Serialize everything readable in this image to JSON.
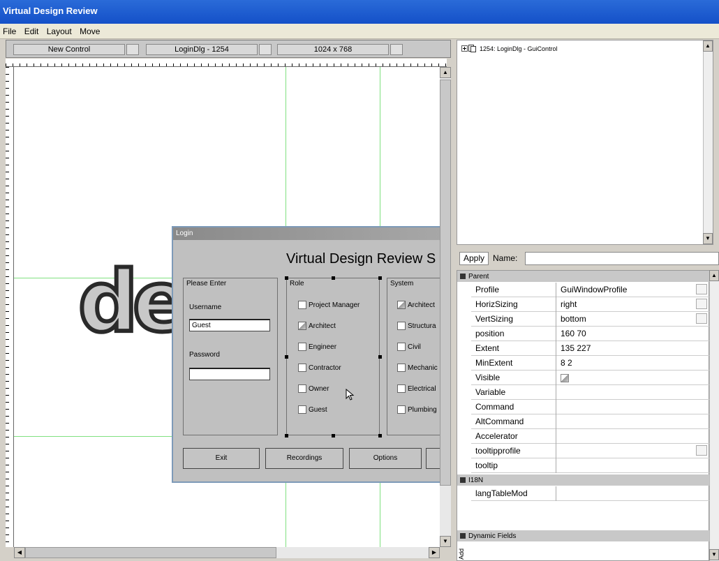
{
  "window": {
    "title": "Virtual Design Review"
  },
  "menu": [
    "File",
    "Edit",
    "Layout",
    "Move"
  ],
  "control_bar": {
    "new_control": "New Control",
    "control_name": "LoginDlg - 1254",
    "resolution": "1024 x 768"
  },
  "canvas": {
    "logo_text": "de",
    "dialog": {
      "title": "Login",
      "heading": "Virtual Design Review S",
      "please_enter": {
        "label": "Please Enter",
        "username_label": "Username",
        "username_value": "Guest",
        "password_label": "Password",
        "password_value": ""
      },
      "role": {
        "label": "Role",
        "options": [
          {
            "label": "Project Manager",
            "checked": false
          },
          {
            "label": "Architect",
            "checked": true
          },
          {
            "label": "Engineer",
            "checked": false
          },
          {
            "label": "Contractor",
            "checked": false
          },
          {
            "label": "Owner",
            "checked": false
          },
          {
            "label": "Guest",
            "checked": false
          }
        ]
      },
      "system": {
        "label": "System",
        "options": [
          {
            "label": "Architect",
            "checked": true
          },
          {
            "label": "Structura",
            "checked": false
          },
          {
            "label": "Civil",
            "checked": false
          },
          {
            "label": "Mechanic",
            "checked": false
          },
          {
            "label": "Electrical",
            "checked": false
          },
          {
            "label": "Plumbing",
            "checked": false
          }
        ]
      },
      "buttons": [
        "Exit",
        "Recordings",
        "Options"
      ]
    }
  },
  "tree": {
    "item": "1254: LoginDlg - GuiControl"
  },
  "inspector": {
    "apply": "Apply",
    "name_label": "Name:",
    "sections": {
      "parent": "Parent",
      "i18n": "I18N",
      "dynamic": "Dynamic Fields"
    },
    "parent_fields": [
      {
        "name": "Profile",
        "value": "GuiWindowProfile"
      },
      {
        "name": "HorizSizing",
        "value": "right"
      },
      {
        "name": "VertSizing",
        "value": "bottom"
      },
      {
        "name": "position",
        "value": "160 70"
      },
      {
        "name": "Extent",
        "value": "135 227"
      },
      {
        "name": "MinExtent",
        "value": "8 2"
      },
      {
        "name": "Visible",
        "value": ""
      },
      {
        "name": "Variable",
        "value": ""
      },
      {
        "name": "Command",
        "value": ""
      },
      {
        "name": "AltCommand",
        "value": ""
      },
      {
        "name": "Accelerator",
        "value": ""
      },
      {
        "name": "tooltipprofile",
        "value": ""
      },
      {
        "name": "tooltip",
        "value": ""
      }
    ],
    "i18n_fields": [
      {
        "name": "langTableMod",
        "value": ""
      }
    ],
    "add_tab": "Add"
  }
}
